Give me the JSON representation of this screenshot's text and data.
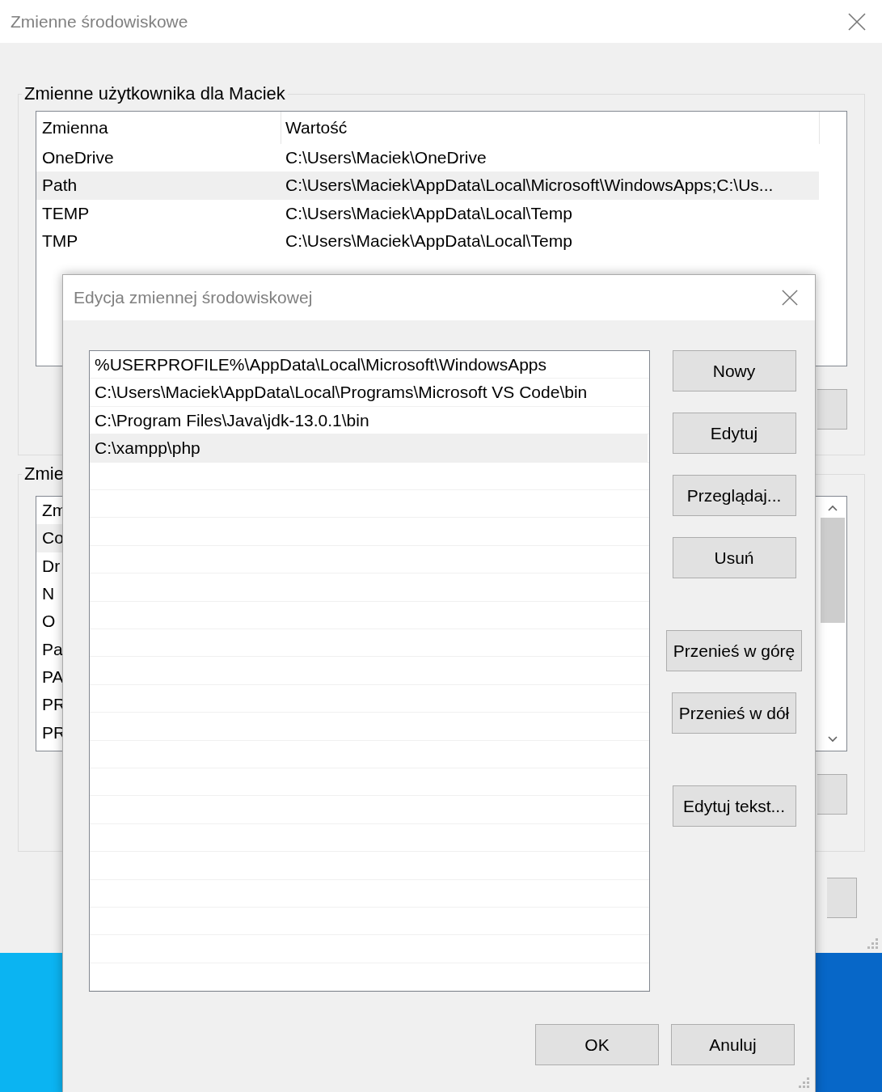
{
  "window": {
    "title": "Zmienne środowiskowe"
  },
  "user_variables": {
    "title": "Zmienne użytkownika dla Maciek",
    "columns": [
      "Zmienna",
      "Wartość"
    ],
    "rows": [
      {
        "name": "OneDrive",
        "value": "C:\\Users\\Maciek\\OneDrive",
        "selected": false
      },
      {
        "name": "Path",
        "value": "C:\\Users\\Maciek\\AppData\\Local\\Microsoft\\WindowsApps;C:\\Us...",
        "selected": true
      },
      {
        "name": "TEMP",
        "value": "C:\\Users\\Maciek\\AppData\\Local\\Temp",
        "selected": false
      },
      {
        "name": "TMP",
        "value": "C:\\Users\\Maciek\\AppData\\Local\\Temp",
        "selected": false
      }
    ]
  },
  "system_variables": {
    "title": "Zmie",
    "header": "Zm",
    "rows": [
      {
        "name": "Co",
        "selected": true
      },
      {
        "name": "Dr",
        "selected": false
      },
      {
        "name": "N",
        "selected": false
      },
      {
        "name": "O",
        "selected": false
      },
      {
        "name": "Pa",
        "selected": false
      },
      {
        "name": "PA",
        "selected": false
      },
      {
        "name": "PR",
        "selected": false
      },
      {
        "name": "PR",
        "selected": false
      }
    ]
  },
  "dialog": {
    "title": "Edycja zmiennej środowiskowej",
    "entries": [
      {
        "text": "%USERPROFILE%\\AppData\\Local\\Microsoft\\WindowsApps",
        "selected": false
      },
      {
        "text": "C:\\Users\\Maciek\\AppData\\Local\\Programs\\Microsoft VS Code\\bin",
        "selected": false
      },
      {
        "text": "C:\\Program Files\\Java\\jdk-13.0.1\\bin",
        "selected": false
      },
      {
        "text": "C:\\xampp\\php",
        "selected": true
      }
    ],
    "button_groups": [
      [
        "Nowy",
        "Edytuj",
        "Przeglądaj...",
        "Usuń"
      ],
      [
        "Przenieś w górę",
        "Przenieś w dół"
      ],
      [
        "Edytuj tekst..."
      ]
    ],
    "footer_buttons": [
      "OK",
      "Anuluj"
    ]
  }
}
